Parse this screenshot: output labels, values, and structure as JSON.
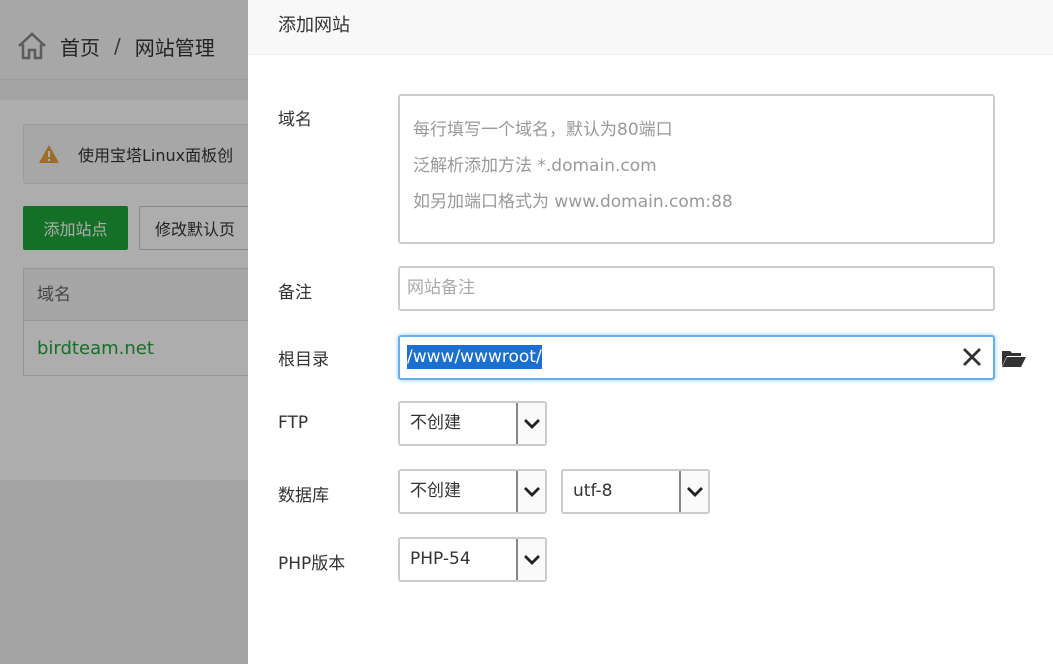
{
  "background": {
    "breadcrumb": {
      "home": "首页",
      "separator": "/",
      "current": "网站管理"
    },
    "alert_text": "使用宝塔Linux面板创",
    "buttons": {
      "add_site": "添加站点",
      "modify_default": "修改默认页"
    },
    "table": {
      "header_domain": "域名",
      "rows": [
        {
          "domain": "birdteam.net"
        }
      ]
    }
  },
  "dialog": {
    "title": "添加网站",
    "fields": {
      "domain": {
        "label": "域名",
        "placeholder_lines": [
          "每行填写一个域名，默认为80端口",
          "泛解析添加方法 *.domain.com",
          "如另加端口格式为 www.domain.com:88"
        ]
      },
      "remark": {
        "label": "备注",
        "placeholder": "网站备注"
      },
      "root": {
        "label": "根目录",
        "value": "/www/wwwroot/"
      },
      "ftp": {
        "label": "FTP",
        "selected": "不创建"
      },
      "database": {
        "label": "数据库",
        "selected": "不创建",
        "charset": "utf-8"
      },
      "php": {
        "label": "PHP版本",
        "selected": "PHP-54"
      }
    }
  },
  "colors": {
    "accent_green": "#20a53a",
    "focus_blue": "#66afe9",
    "selection_blue": "#1a6fd0"
  }
}
